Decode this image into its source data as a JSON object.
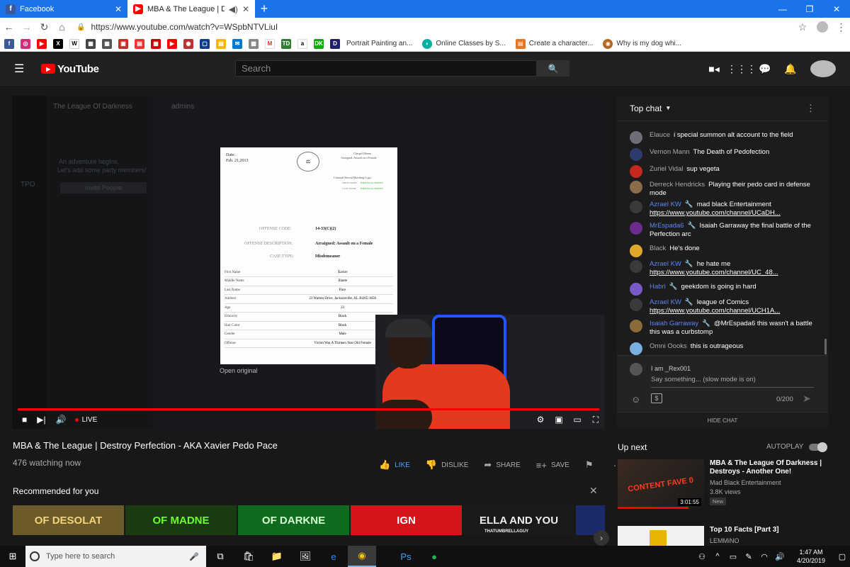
{
  "browser": {
    "tabs": [
      {
        "label": "Facebook",
        "active": false
      },
      {
        "label": "MBA & The League | Destroy",
        "active": true
      }
    ],
    "url": "https://www.youtube.com/watch?v=WSpbNTVLiuI",
    "bookmarks": [
      {
        "label": "Portrait Painting an..."
      },
      {
        "label": "Online Classes by S..."
      },
      {
        "label": "Create a character..."
      },
      {
        "label": "Why is my dog whi..."
      }
    ]
  },
  "youtube": {
    "logo_text": "YouTube",
    "search_placeholder": "Search"
  },
  "player": {
    "live_label": "LIVE",
    "open_original": "Open original",
    "discord": {
      "server_name": "The League Of Darkness",
      "channel_name": "admins",
      "invite_button": "Invite People",
      "empty_line1": "An adventure begins.",
      "empty_line2": "Let's add some party members!",
      "server_tag": "TPO"
    },
    "document": {
      "date_label": "Date:",
      "date_value": "Feb. 21,2013",
      "header_right1": "Charge/Offense",
      "header_right2": "Arraigned: Assault on a Female",
      "match_title": "Criminal Record Matching Logic",
      "match1_label": "FIRST NAME",
      "match1_value": "IDENTICAL MATCH",
      "match2_label": "LAST NAME",
      "match2_value": "IDENTICAL MATCH",
      "offense_code_label": "OFFENSE CODE:",
      "offense_code_value": "14-33(C)(2)",
      "offense_desc_label": "OFFENSE DESCRIPTION:",
      "offense_desc_value": "Arraigned: Assault on a Female",
      "case_type_label": "CASE TYPE:",
      "case_type_value": "Misdemeanor",
      "rows": [
        {
          "label": "First Name",
          "value": "Xavier"
        },
        {
          "label": "Middle Name",
          "value": "Jilante"
        },
        {
          "label": "Last Name",
          "value": "Pace"
        },
        {
          "label": "Address",
          "value": "23 Warren Drive, Jacksonville, AL 36265-3656"
        },
        {
          "label": "Age",
          "value": "23"
        },
        {
          "label": "Ethnicity",
          "value": "Black"
        },
        {
          "label": "Hair Color",
          "value": "Black"
        },
        {
          "label": "Gender",
          "value": "Male"
        },
        {
          "label": "Offense",
          "value": "Victim Was A Thirteen Year Old Female"
        }
      ]
    }
  },
  "video": {
    "title": "MBA & The League | Destroy Perfection - AKA Xavier Pedo Pace",
    "watching": "476 watching now",
    "like_label": "LIKE",
    "dislike_label": "DISLIKE",
    "share_label": "SHARE",
    "save_label": "SAVE"
  },
  "recommended": {
    "title": "Recommended for you",
    "thumbs": [
      {
        "text": "OF DESOLAT",
        "bg": "#6b5a2a",
        "fg": "#f3d27a"
      },
      {
        "text": "OF MADNE",
        "bg": "#1a3a12",
        "fg": "#6cff2c"
      },
      {
        "text": "OF DARKNE",
        "bg": "#0e6a1c",
        "fg": "#d6ffd0"
      },
      {
        "text": "IGN",
        "bg": "#d3141a",
        "fg": "#ffffff"
      },
      {
        "text": "ELLA AND YOU",
        "bg": "#1a1a1a",
        "fg": "#eeeeee",
        "sub": "THATUMBRELLAGUY"
      },
      {
        "text": "",
        "bg": "#1b2a6b",
        "fg": "#ffffff"
      }
    ]
  },
  "chat": {
    "header": "Top chat",
    "messages": [
      {
        "author": "Elauce",
        "text": "i special summon alt account to the field",
        "color": "#6b6f79",
        "owner": false
      },
      {
        "author": "Vernon Mann",
        "text": "The Death of Pedofection",
        "color": "#2e3a6b",
        "owner": false
      },
      {
        "author": "Zuriel Vidal",
        "text": "sup vegeta",
        "color": "#c5281f",
        "owner": false
      },
      {
        "author": "Derreck Hendricks",
        "text": "Playing their pedo card in defense mode",
        "color": "#8a6b4a",
        "owner": false
      },
      {
        "author": "Azrael KW",
        "text": "mad black Entertainment",
        "link": "https://www.youtube.com/channel/UCaDH...",
        "color": "#3a3a3a",
        "owner": true
      },
      {
        "author": "MrEspada6",
        "text": "Isaiah Garraway the final battle of the Perfection arc",
        "color": "#6b2b8f",
        "owner": true
      },
      {
        "author": "Black",
        "text": "He's done",
        "color": "#e1a72b",
        "owner": false
      },
      {
        "author": "Azrael KW",
        "text": "he hate me",
        "link": "https://www.youtube.com/channel/UC_48...",
        "color": "#3a3a3a",
        "owner": true
      },
      {
        "author": "Habri",
        "text": "geekdom is going in hard",
        "color": "#7a5ac9",
        "owner": true
      },
      {
        "author": "Azrael KW",
        "text": "league of Comics",
        "link": "https://www.youtube.com/channel/UCH1A...",
        "color": "#3a3a3a",
        "owner": true
      },
      {
        "author": "Isaiah Garraway",
        "text": "@MrEspada6 this wasn't a battle this was a curbstomp",
        "color": "#8a6b3a",
        "owner": true
      },
      {
        "author": "Omni Oooks",
        "text": "this is outrageous",
        "color": "#7ab0e0",
        "owner": false
      }
    ],
    "input_user": "I am _Rex001",
    "input_placeholder": "Say something... (slow mode is on)",
    "char_count": "0/200",
    "hide_label": "HIDE CHAT"
  },
  "upnext": {
    "title": "Up next",
    "autoplay_label": "AUTOPLAY",
    "videos": [
      {
        "title": "MBA & The League Of Darkness | Destroys - Another One!",
        "channel": "Mad Black Entertainment",
        "views": "3.8K views",
        "badge": "New",
        "duration": "3:01:55",
        "thumb_text": "CONTENT FAVE 0",
        "progress": 0.82
      },
      {
        "title": "Top 10 Facts [Part 3]",
        "channel": "LEMMiNO",
        "views": "",
        "badge": "",
        "duration": "",
        "thumb_text": ""
      }
    ]
  },
  "taskbar": {
    "search_placeholder": "Type here to search",
    "time": "1:47 AM",
    "date": "4/20/2019"
  }
}
